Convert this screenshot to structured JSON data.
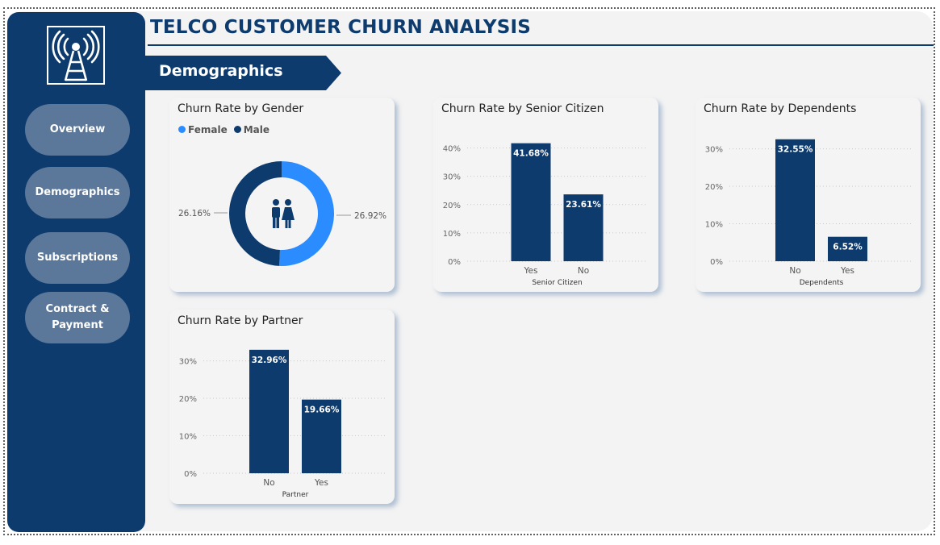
{
  "header": {
    "title": "TELCO CUSTOMER CHURN ANALYSIS",
    "section": "Demographics"
  },
  "sidebar": {
    "logo_icon": "radio-tower-icon",
    "items": [
      {
        "label": "Overview"
      },
      {
        "label": "Demographics"
      },
      {
        "label": "Subscriptions"
      },
      {
        "label": "Contract &\nPayment"
      }
    ]
  },
  "colors": {
    "navy": "#0d3b6e",
    "female": "#2a8cff",
    "male": "#0d3b6e",
    "nav_button": "#5b7799"
  },
  "chart_data": [
    {
      "id": "gender",
      "type": "pie",
      "title": "Churn Rate by Gender",
      "legend": "top-left",
      "categories": [
        "Female",
        "Male"
      ],
      "values": [
        26.92,
        26.16
      ],
      "labels": [
        "26.92%",
        "26.16%"
      ],
      "center_icon": "people-icon"
    },
    {
      "id": "senior",
      "type": "bar",
      "title": "Churn Rate by Senior Citizen",
      "categories": [
        "Yes",
        "No"
      ],
      "values": [
        41.68,
        23.61
      ],
      "labels": [
        "41.68%",
        "23.61%"
      ],
      "xlabel": "Senior Citizen",
      "yticks": [
        "0%",
        "10%",
        "20%",
        "30%",
        "40%"
      ],
      "ylim": [
        0,
        45
      ]
    },
    {
      "id": "dependents",
      "type": "bar",
      "title": "Churn Rate by Dependents",
      "categories": [
        "No",
        "Yes"
      ],
      "values": [
        32.55,
        6.52
      ],
      "labels": [
        "32.55%",
        "6.52%"
      ],
      "xlabel": "Dependents",
      "yticks": [
        "0%",
        "10%",
        "20%",
        "30%"
      ],
      "ylim": [
        0,
        34
      ]
    },
    {
      "id": "partner",
      "type": "bar",
      "title": "Churn Rate by Partner",
      "categories": [
        "No",
        "Yes"
      ],
      "values": [
        32.96,
        19.66
      ],
      "labels": [
        "32.96%",
        "19.66%"
      ],
      "xlabel": "Partner",
      "yticks": [
        "0%",
        "10%",
        "20%",
        "30%"
      ],
      "ylim": [
        0,
        34
      ]
    }
  ]
}
